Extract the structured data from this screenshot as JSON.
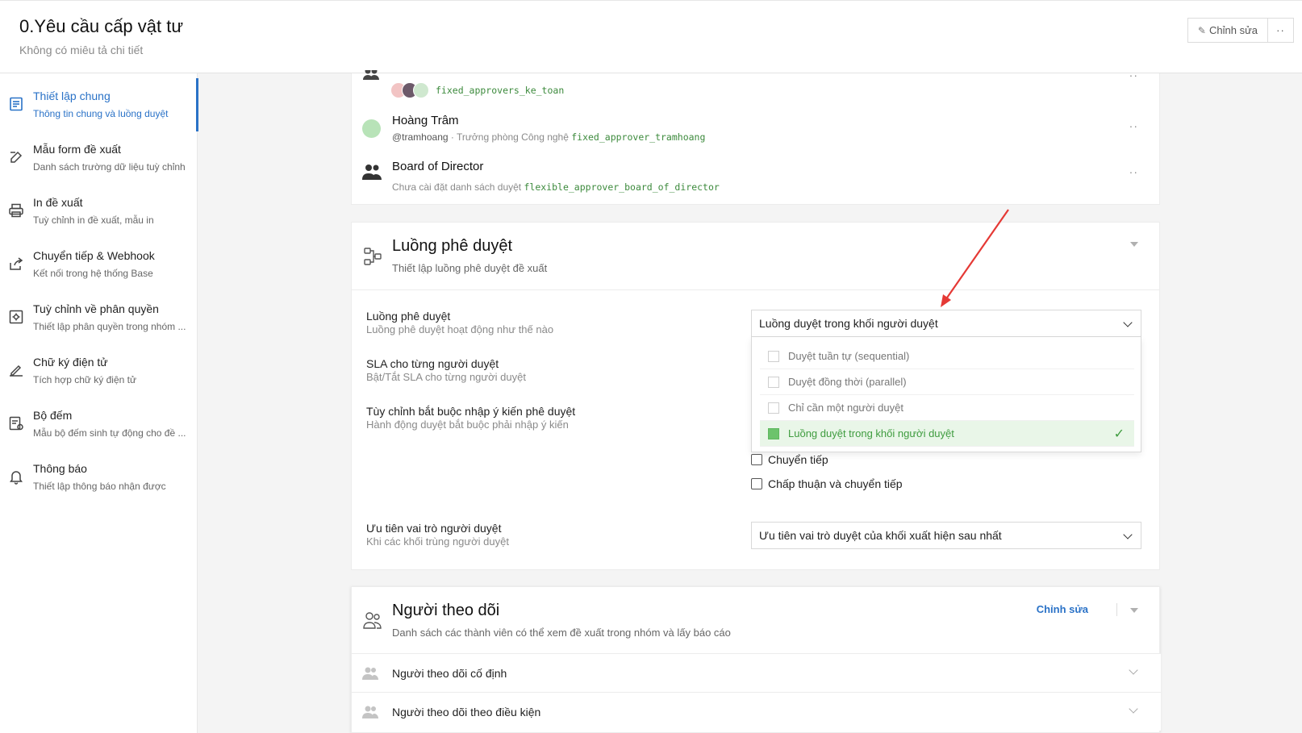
{
  "header": {
    "title": "0.Yêu cầu cấp vật tư",
    "subtitle": "Không có miêu tả chi tiết",
    "edit_label": "Chỉnh sửa",
    "more_label": "··"
  },
  "sidebar": {
    "items": [
      {
        "label": "Thiết lập chung",
        "sub": "Thông tin chung và luồng duyệt",
        "icon": "document-icon",
        "active": true
      },
      {
        "label": "Mẫu form đề xuất",
        "sub": "Danh sách trường dữ liệu tuỳ chỉnh",
        "icon": "edit-icon"
      },
      {
        "label": "In đề xuất",
        "sub": "Tuỳ chỉnh in đề xuất, mẫu in",
        "icon": "printer-icon"
      },
      {
        "label": "Chuyển tiếp & Webhook",
        "sub": "Kết nối trong hệ thống Base",
        "icon": "share-icon"
      },
      {
        "label": "Tuỳ chỉnh về phân quyền",
        "sub": "Thiết lập phân quyền trong nhóm ...",
        "icon": "settings-icon"
      },
      {
        "label": "Chữ ký điện tử",
        "sub": "Tích hợp chữ ký điện tử",
        "icon": "signature-icon"
      },
      {
        "label": "Bộ đếm",
        "sub": "Mẫu bộ đếm sinh tự động cho đề ...",
        "icon": "counter-icon"
      },
      {
        "label": "Thông báo",
        "sub": "Thiết lập thông báo nhận được",
        "icon": "bell-icon"
      }
    ]
  },
  "approvers": {
    "group1": {
      "code": "fixed_approvers_ke_toan"
    },
    "person": {
      "name": "Hoàng Trâm",
      "handle": "@tramhoang",
      "role": " · Trưởng phòng Công nghệ ",
      "code": "fixed_approver_tramhoang"
    },
    "board": {
      "name": "Board of Director",
      "note": "Chưa cài đặt danh sách duyệt ",
      "code": "flexible_approver_board_of_director"
    },
    "more": "··"
  },
  "flow": {
    "title": "Luồng phê duyệt",
    "subtitle": "Thiết lập luồng phê duyệt đề xuất",
    "rows": [
      {
        "label": "Luồng phê duyệt",
        "sub": "Luồng phê duyệt hoạt động như thế nào"
      },
      {
        "label": "SLA cho từng người duyệt",
        "sub": "Bật/Tắt SLA cho từng người duyệt"
      },
      {
        "label": "Tùy chỉnh bắt buộc nhập ý kiến phê duyệt",
        "sub": "Hành động duyệt bắt buộc phải nhập ý kiến"
      },
      {
        "label": "Ưu tiên vai trò người duyệt",
        "sub": "Khi các khối trùng người duyệt"
      }
    ],
    "select_value": "Luồng duyệt trong khối người duyệt",
    "options": [
      {
        "label": "Duyệt tuần tự (sequential)"
      },
      {
        "label": "Duyệt đồng thời (parallel)"
      },
      {
        "label": "Chỉ cần một người duyệt"
      },
      {
        "label": "Luồng duyệt trong khối người duyệt",
        "selected": true
      }
    ],
    "checkboxes": [
      "Chuyển tiếp",
      "Chấp thuận và chuyển tiếp"
    ],
    "priority_value": "Ưu tiên vai trò duyệt của khối xuất hiện sau nhất"
  },
  "followers": {
    "title": "Người theo dõi",
    "subtitle": "Danh sách các thành viên có thể xem đề xuất trong nhóm và lấy báo cáo",
    "edit_label": "Chỉnh sửa",
    "rows": [
      {
        "label": "Người theo dõi cố định"
      },
      {
        "label": "Người theo dõi theo điều kiện"
      }
    ]
  },
  "colors": {
    "accent": "#2a72c7",
    "selected_green": "#3f9c3f",
    "arrow_red": "#e53935"
  }
}
